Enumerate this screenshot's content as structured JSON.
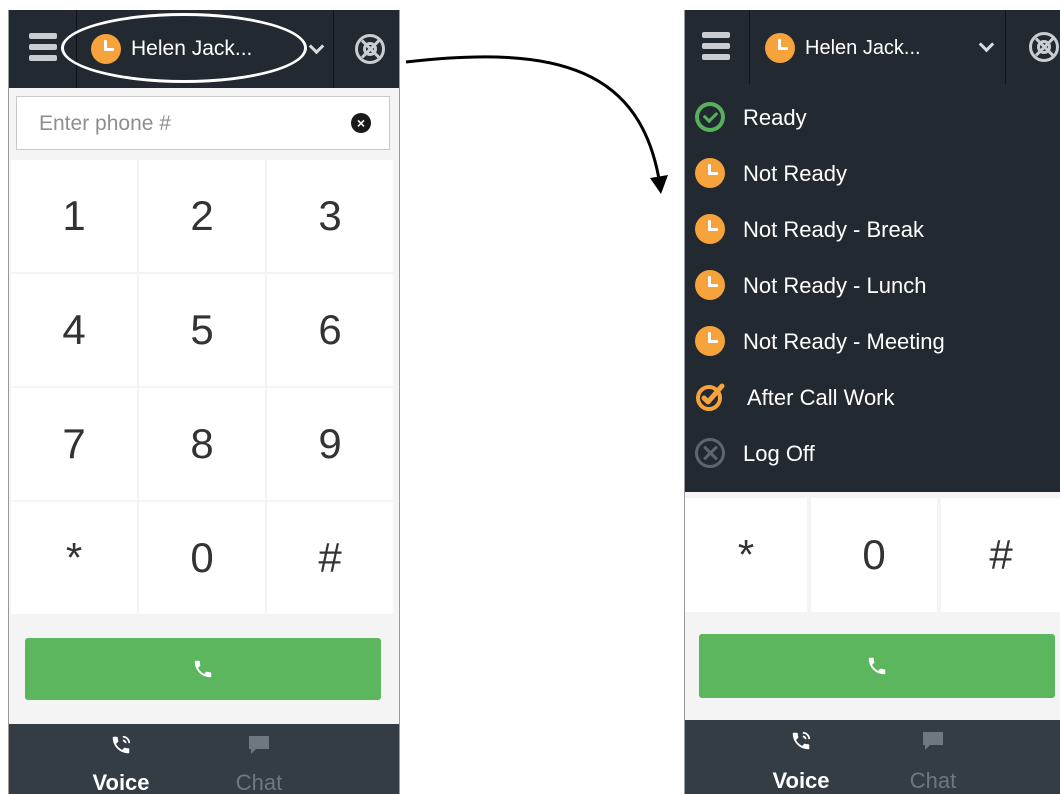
{
  "agent": {
    "name": "Helen Jack..."
  },
  "dialer": {
    "placeholder": "Enter phone #",
    "clear_symbol": "×",
    "keys": [
      "1",
      "2",
      "3",
      "4",
      "5",
      "6",
      "7",
      "8",
      "9",
      "*",
      "0",
      "#"
    ]
  },
  "status_menu": {
    "items": [
      {
        "label": "Ready",
        "icon": "ready-check-icon"
      },
      {
        "label": "Not Ready",
        "icon": "clock-icon"
      },
      {
        "label": "Not Ready - Break",
        "icon": "clock-icon"
      },
      {
        "label": "Not Ready - Lunch",
        "icon": "clock-icon"
      },
      {
        "label": "Not Ready - Meeting",
        "icon": "clock-icon"
      },
      {
        "label": "After Call Work",
        "icon": "after-call-work-icon"
      },
      {
        "label": "Log Off",
        "icon": "log-off-icon"
      }
    ]
  },
  "nav": {
    "voice_label": "Voice",
    "chat_label": "Chat"
  },
  "colors": {
    "header_bg": "#222930",
    "nav_bg": "#343c44",
    "call_green": "#5cb65e",
    "status_orange": "#f5a33a",
    "ready_green": "#56b15a"
  }
}
